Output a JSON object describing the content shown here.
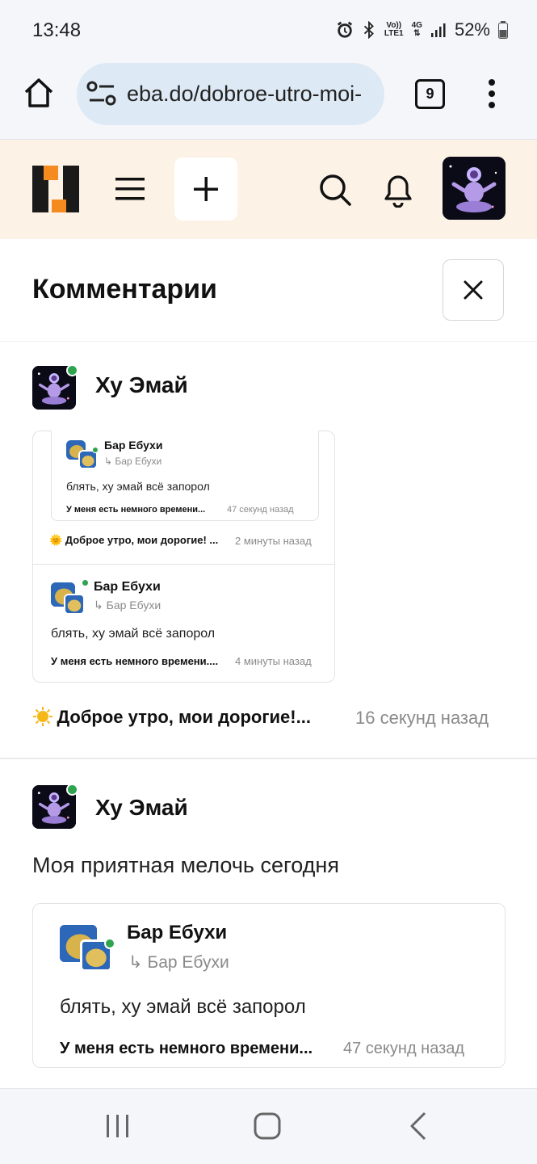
{
  "status_bar": {
    "time": "13:48",
    "network_top": "Vo))",
    "network_bottom": "LTE1",
    "network_type": "4G",
    "battery": "52%"
  },
  "browser": {
    "url": "eba.do/dobroe-utro-moi-",
    "tab_count": "9",
    "icons": [
      "home-icon",
      "site-settings-icon",
      "tabs-icon",
      "more-vert-icon"
    ]
  },
  "site_header": {
    "icons": [
      "site-logo",
      "menu-icon",
      "plus-icon",
      "search-icon",
      "bell-icon",
      "user-avatar"
    ]
  },
  "comments": {
    "title": "Комментарии",
    "items": [
      {
        "author": "Ху Эмай",
        "quoted": {
          "nested": {
            "author": "Бар Ебухи",
            "reply_to": "Бар Ебухи",
            "text": "блять, ху эмай всё запорол",
            "post": "У меня есть немного времени...",
            "time": "47 секунд назад"
          },
          "post": "🌞 Доброе утро, мои дорогие! ...",
          "post_time": "2 минуты назад",
          "reply": {
            "author": "Бар Ебухи",
            "reply_to": "Бар Ебухи",
            "text": "блять, ху эмай всё запорол",
            "post": "У меня есть немного времени....",
            "time": "4 минуты назад"
          }
        },
        "post": "Доброе утро, мои дорогие!...",
        "time": "16 секунд назад"
      },
      {
        "author": "Ху Эмай",
        "text": "Моя приятная мелочь сегодня",
        "quoted": {
          "author": "Бар Ебухи",
          "reply_to": "Бар Ебухи",
          "text": "блять, ху эмай всё запорол",
          "post": "У меня есть немного времени...",
          "time": "47 секунд назад"
        }
      }
    ]
  },
  "colors": {
    "header_bg": "#fdf2e6",
    "url_bg": "#dde9f4",
    "online": "#2ea44f",
    "logo_orange": "#f58a1f"
  }
}
